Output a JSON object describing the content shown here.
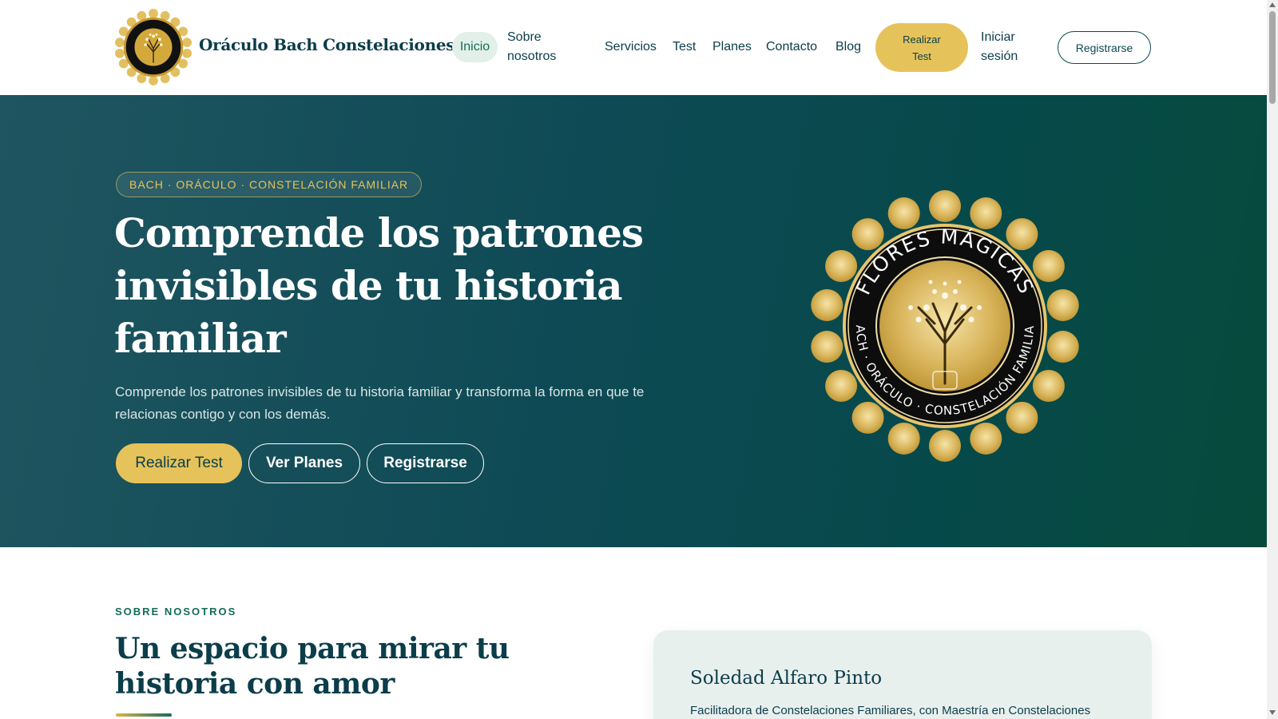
{
  "header": {
    "brand": "Oráculo Bach Constelaciones",
    "logo_icon": "flores-magicas-seal-logo",
    "nav": {
      "inicio": "Inicio",
      "sobre_1": "Sobre",
      "sobre_2": "nosotros",
      "servicios": "Servicios",
      "test": "Test",
      "planes": "Planes",
      "contacto": "Contacto",
      "blog": "Blog",
      "cta_1": "Realizar",
      "cta_2": "Test",
      "login_1": "Iniciar",
      "login_2": "sesión",
      "register": "Registrarse"
    }
  },
  "hero": {
    "badge": "BACH · ORÁCULO · CONSTELACIÓN FAMILIAR",
    "title": "Comprende los patrones invisibles de tu historia familiar",
    "subtitle": "Comprende los patrones invisibles de tu historia familiar y transforma la forma en que te relacionas contigo y con los demás.",
    "buttons": {
      "primary": "Realizar Test",
      "plans": "Ver Planes",
      "register": "Registrarse"
    },
    "seal": {
      "top_text": "FLORES MÁGICAS",
      "bottom_text": "BACH · ORÁCULO · CONSTELACIÓN FAMILIAR"
    }
  },
  "about": {
    "kicker": "SOBRE NOSOTROS",
    "title": "Un espacio para mirar tu historia con amor",
    "card": {
      "name": "Soledad Alfaro Pinto",
      "text": "Facilitadora de Constelaciones Familiares, con Maestría en Constelaciones"
    }
  },
  "colors": {
    "brand_dark": "#0b3d4a",
    "accent_gold": "#e6c35a",
    "hero_teal": "#0e4a55",
    "active_green": "#13705a"
  }
}
